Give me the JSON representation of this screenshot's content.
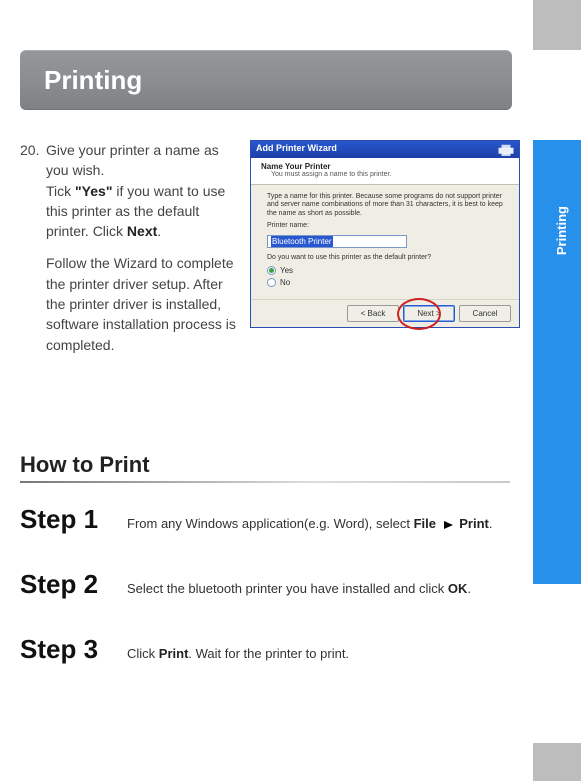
{
  "page": {
    "title_bar": "Printing",
    "side_tab": "Printing"
  },
  "step20": {
    "number": "20.",
    "p1_a": "Give your printer a name as you wish.",
    "p1_b_pre": "Tick ",
    "p1_b_bold": "\"Yes\"",
    "p1_b_post": " if you want to use this printer as the default printer. Click ",
    "p1_b_next": "Next",
    "p1_b_end": ".",
    "p2": "Follow the Wizard to complete the printer driver setup.  After the printer driver is installed, software installation process is completed."
  },
  "wizard": {
    "title": "Add Printer Wizard",
    "head_title": "Name Your Printer",
    "head_sub": "You must assign a name to this printer.",
    "body_intro": "Type a name for this printer. Because some programs do not support printer and server name combinations of more than 31 characters, it is best to keep the name as short as possible.",
    "printer_name_label": "Printer name:",
    "printer_name_value": "Bluetooth Printer",
    "default_q": "Do you want to use this printer as the default printer?",
    "opt_yes": "Yes",
    "opt_no": "No",
    "btn_back": "< Back",
    "btn_next": "Next >",
    "btn_cancel": "Cancel"
  },
  "howto": {
    "heading": "How to Print",
    "s1_label": "Step 1",
    "s1_a": "From any Windows application(e.g. Word), select ",
    "s1_file": "File",
    "s1_print": "Print",
    "s1_end": ".",
    "s2_label": "Step 2",
    "s2_a": "Select the bluetooth printer you have installed and click ",
    "s2_ok": "OK",
    "s2_end": ".",
    "s3_label": "Step 3",
    "s3_a": "Click ",
    "s3_print": "Print",
    "s3_b": ". Wait for the printer to print."
  }
}
